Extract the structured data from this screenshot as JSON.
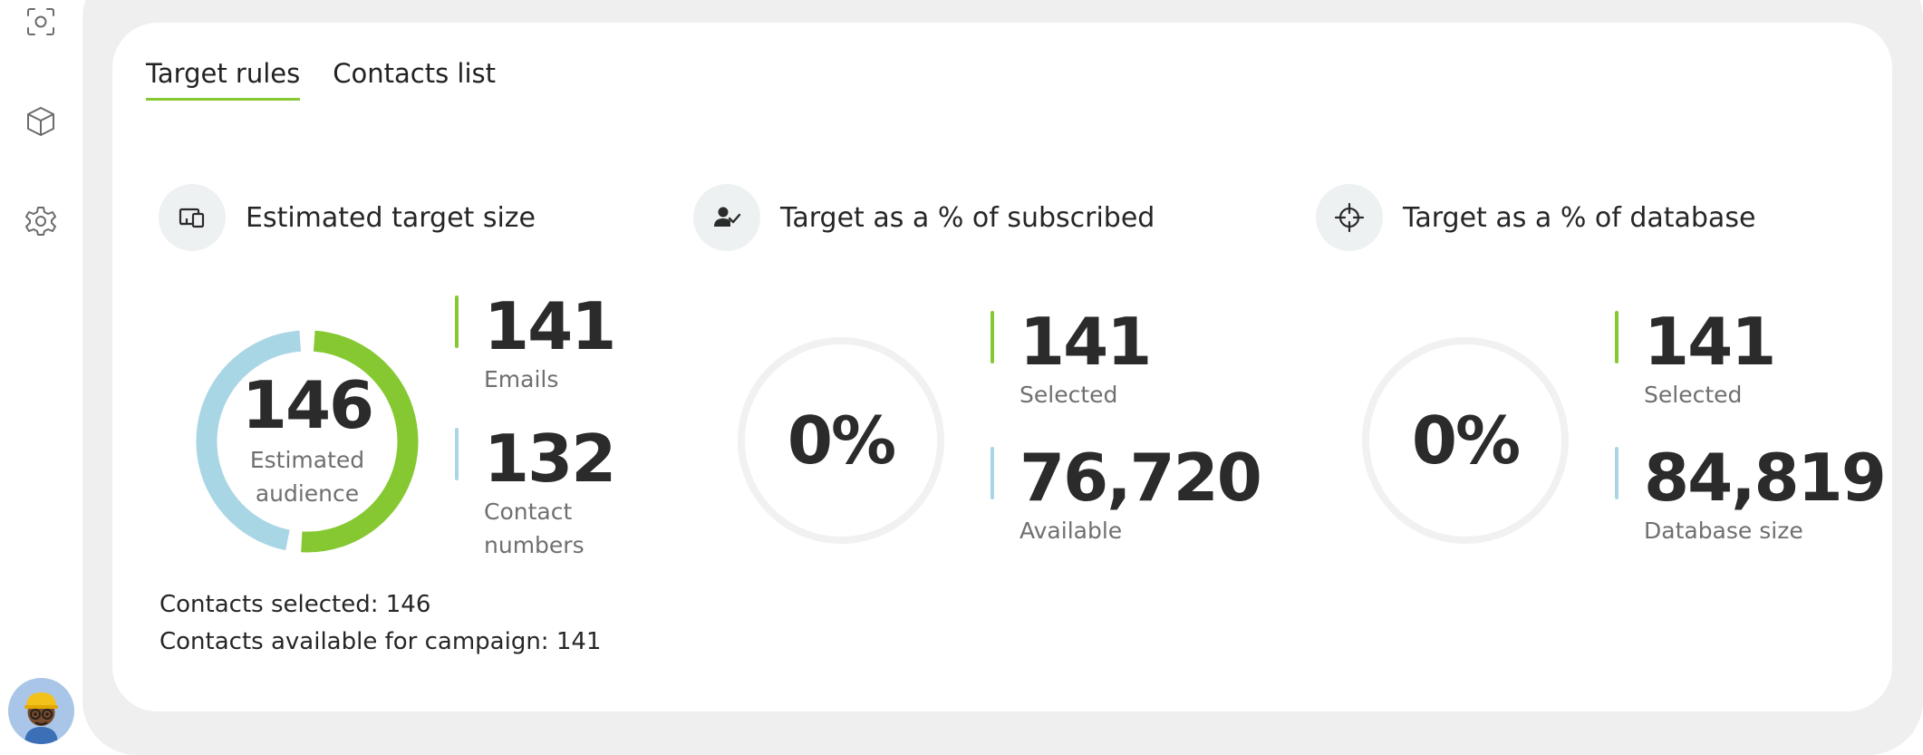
{
  "sidebar": {
    "items": [
      {
        "icon": "scan-icon"
      },
      {
        "icon": "cube-icon"
      },
      {
        "icon": "gear-icon"
      }
    ],
    "avatar": "user-avatar"
  },
  "tabs": [
    {
      "label": "Target rules",
      "active": true
    },
    {
      "label": "Contacts list",
      "active": false
    }
  ],
  "sections": {
    "estimated": {
      "title": "Estimated target size",
      "icon": "devices-icon",
      "total": "146",
      "total_label_1": "Estimated",
      "total_label_2": "audience",
      "emails_value": "141",
      "emails_label": "Emails",
      "contacts_value": "132",
      "contacts_label_1": "Contact",
      "contacts_label_2": "numbers",
      "emails_fraction": 0.52,
      "contacts_fraction": 0.48
    },
    "subscribed": {
      "title": "Target as a % of subscribed",
      "icon": "user-check-icon",
      "percent": "0%",
      "selected_value": "141",
      "selected_label": "Selected",
      "available_value": "76,720",
      "available_label": "Available"
    },
    "database": {
      "title": "Target as a % of database",
      "icon": "crosshair-icon",
      "percent": "0%",
      "selected_value": "141",
      "selected_label": "Selected",
      "size_value": "84,819",
      "size_label": "Database size"
    }
  },
  "notes": {
    "selected": "Contacts selected: 146",
    "available": "Contacts available for campaign: 141"
  },
  "colors": {
    "accent_green": "#86c832",
    "accent_blue": "#a9d6e5",
    "frame_grey": "#efefef"
  }
}
